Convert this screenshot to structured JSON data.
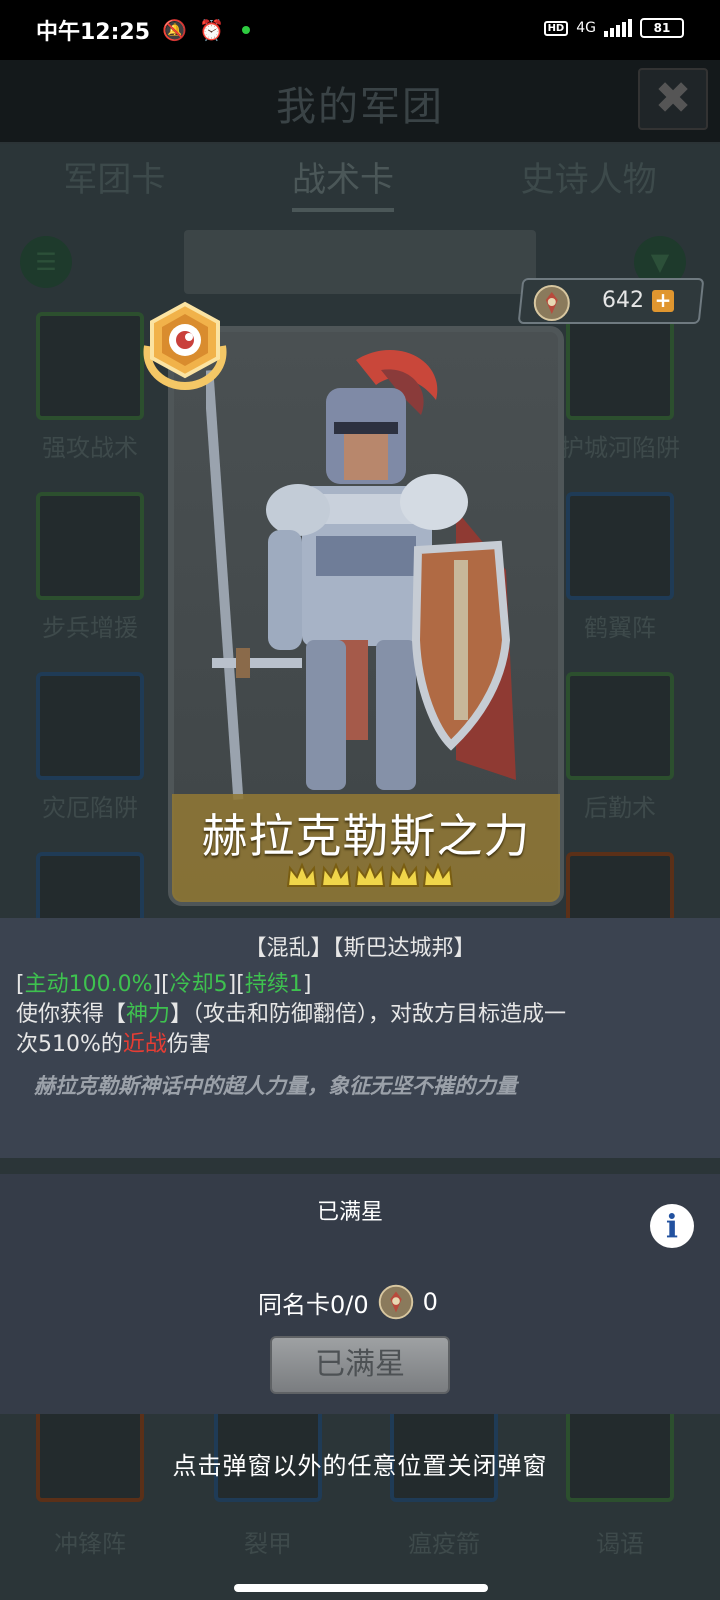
{
  "status_bar": {
    "time": "中午12:25",
    "network": "4G",
    "battery": "81"
  },
  "header": {
    "title": "我的军团"
  },
  "tabs": [
    {
      "label": "军团卡"
    },
    {
      "label": "战术卡"
    },
    {
      "label": "史诗人物"
    }
  ],
  "grid_labels": [
    "强攻战术",
    "护城河陷阱",
    "步兵增援",
    "鹤翼阵",
    "灾厄陷阱",
    "后勤术",
    "冲锋阵",
    "裂甲",
    "瘟疫箭",
    "谒语"
  ],
  "currency": {
    "amount": "642"
  },
  "card": {
    "name": "赫拉克勒斯之力",
    "stars": 5,
    "tags": "【混乱】【斯巴达城邦】",
    "stats": {
      "active": "主动100.0%",
      "cooldown": "冷却5",
      "duration": "持续1"
    },
    "effect_prefix": "使你获得【",
    "effect_keyword": "神力",
    "effect_suffix": "】（攻击和防御翻倍），对敌方目标造成一",
    "effect_line2_prefix": "次510%的",
    "effect_melee": "近战",
    "effect_line2_suffix": "伤害",
    "flavor": "赫拉克勒斯神话中的超人力量，象征无坚不摧的力量"
  },
  "upgrade": {
    "star_status": "已满星",
    "dup_label": "同名卡0/0",
    "dup_cost": "0",
    "button_label": "已满星"
  },
  "close_hint": "点击弹窗以外的任意位置关闭弹窗",
  "colors": {
    "stat_green": "#3ec24f",
    "melee_red": "#e63d34",
    "name_bar": "#8f7834"
  }
}
